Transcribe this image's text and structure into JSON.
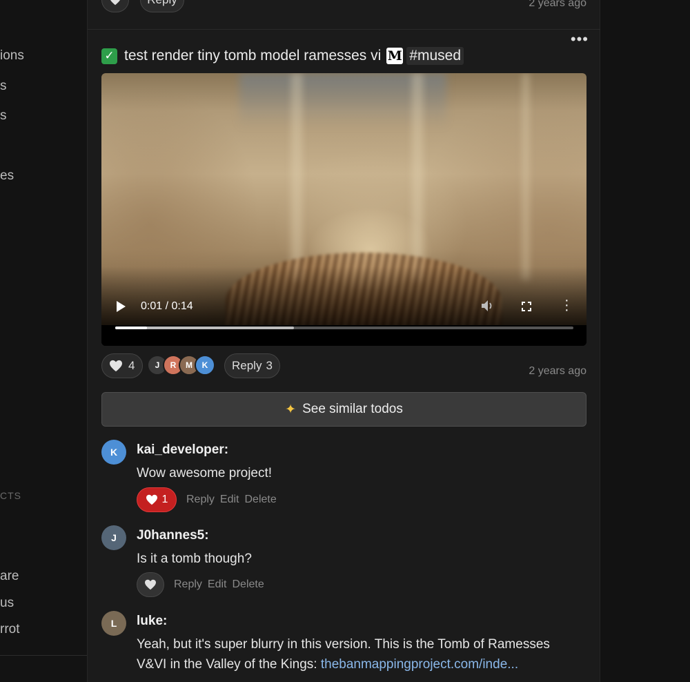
{
  "sidebar": {
    "items": [
      {
        "label": "ions"
      },
      {
        "label": "s"
      },
      {
        "label": "s"
      },
      {
        "label": "es"
      },
      {
        "label": "are"
      },
      {
        "label": "us"
      },
      {
        "label": "rrot"
      }
    ],
    "section_label": "CTS"
  },
  "previous_post": {
    "reply_label": "Reply",
    "time": "2 years ago"
  },
  "post": {
    "title": "test render tiny tomb model ramesses vi",
    "hashtag": "#mused",
    "more_label": "•••",
    "video": {
      "current_time": "0:01",
      "duration": "0:14",
      "time_display": "0:01 / 0:14",
      "played_fraction": 0.07,
      "buffered_fraction": 0.39
    },
    "likes_count": "4",
    "liker_avatars": [
      "J",
      "R",
      "M",
      "K"
    ],
    "reply_label": "Reply",
    "reply_count": "3",
    "time": "2 years ago"
  },
  "similar_button": {
    "label": "See similar todos"
  },
  "comments": [
    {
      "user": "kai_developer:",
      "avatar": "K",
      "text": "Wow awesome project!",
      "like_count": "1",
      "liked": true,
      "actions": [
        "Reply",
        "Edit",
        "Delete"
      ]
    },
    {
      "user": "J0hannes5:",
      "avatar": "J",
      "text": "Is it a tomb though?",
      "like_count": "",
      "liked": false,
      "actions": [
        "Reply",
        "Edit",
        "Delete"
      ]
    },
    {
      "user": "luke:",
      "avatar": "L",
      "text": "Yeah, but it's super blurry in this version. This is the Tomb of Ramesses V&VI in the Valley of the Kings: ",
      "link_text": "thebanmappingproject.com/inde...",
      "actions": []
    }
  ],
  "colors": {
    "background": "#121212",
    "feed": "#1b1b1b",
    "liked": "#c42020",
    "link": "#8ab8ea",
    "check": "#2e9e4a"
  }
}
